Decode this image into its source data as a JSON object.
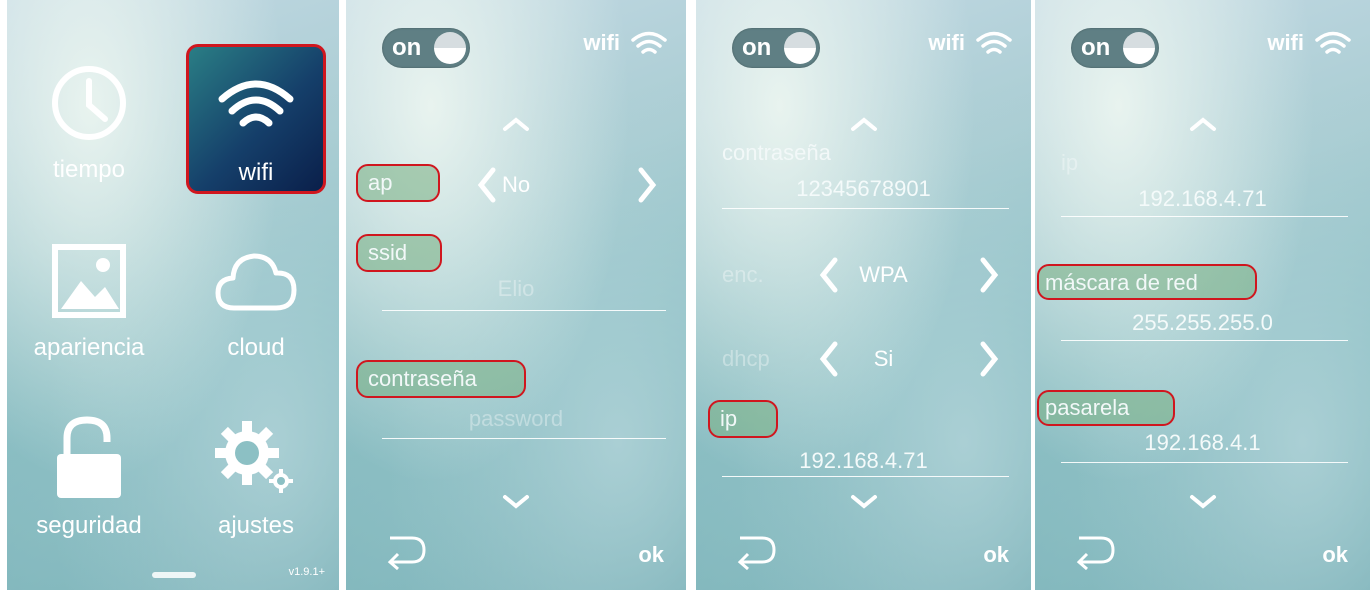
{
  "screen1": {
    "tiles": [
      {
        "label": "tiempo",
        "icon": "clock-icon"
      },
      {
        "label": "wifi",
        "icon": "wifi-icon"
      },
      {
        "label": "apariencia",
        "icon": "image-icon"
      },
      {
        "label": "cloud",
        "icon": "cloud-icon"
      },
      {
        "label": "seguridad",
        "icon": "unlock-icon"
      },
      {
        "label": "ajustes",
        "icon": "gear-icon"
      }
    ],
    "version": "v1.9.1+"
  },
  "common": {
    "toggle_label": "on",
    "wifi_label": "wifi",
    "ok_label": "ok"
  },
  "screen2": {
    "ap_label": "ap",
    "ap_value": "No",
    "ssid_label": "ssid",
    "ssid_value": "Elio",
    "password_label": "contraseña",
    "password_value": "password"
  },
  "screen3": {
    "password_label": "contraseña",
    "password_value": "12345678901",
    "enc_label": "enc.",
    "enc_value": "WPA",
    "dhcp_label": "dhcp",
    "dhcp_value": "Si",
    "ip_label": "ip",
    "ip_value": "192.168.4.71"
  },
  "screen4": {
    "ip_label": "ip",
    "ip_value": "192.168.4.71",
    "netmask_label": "máscara de red",
    "netmask_value": "255.255.255.0",
    "gateway_label": "pasarela",
    "gateway_value": "192.168.4.1"
  },
  "colors": {
    "highlight_border": "#d0161e",
    "active_tile": "#153f6a"
  }
}
